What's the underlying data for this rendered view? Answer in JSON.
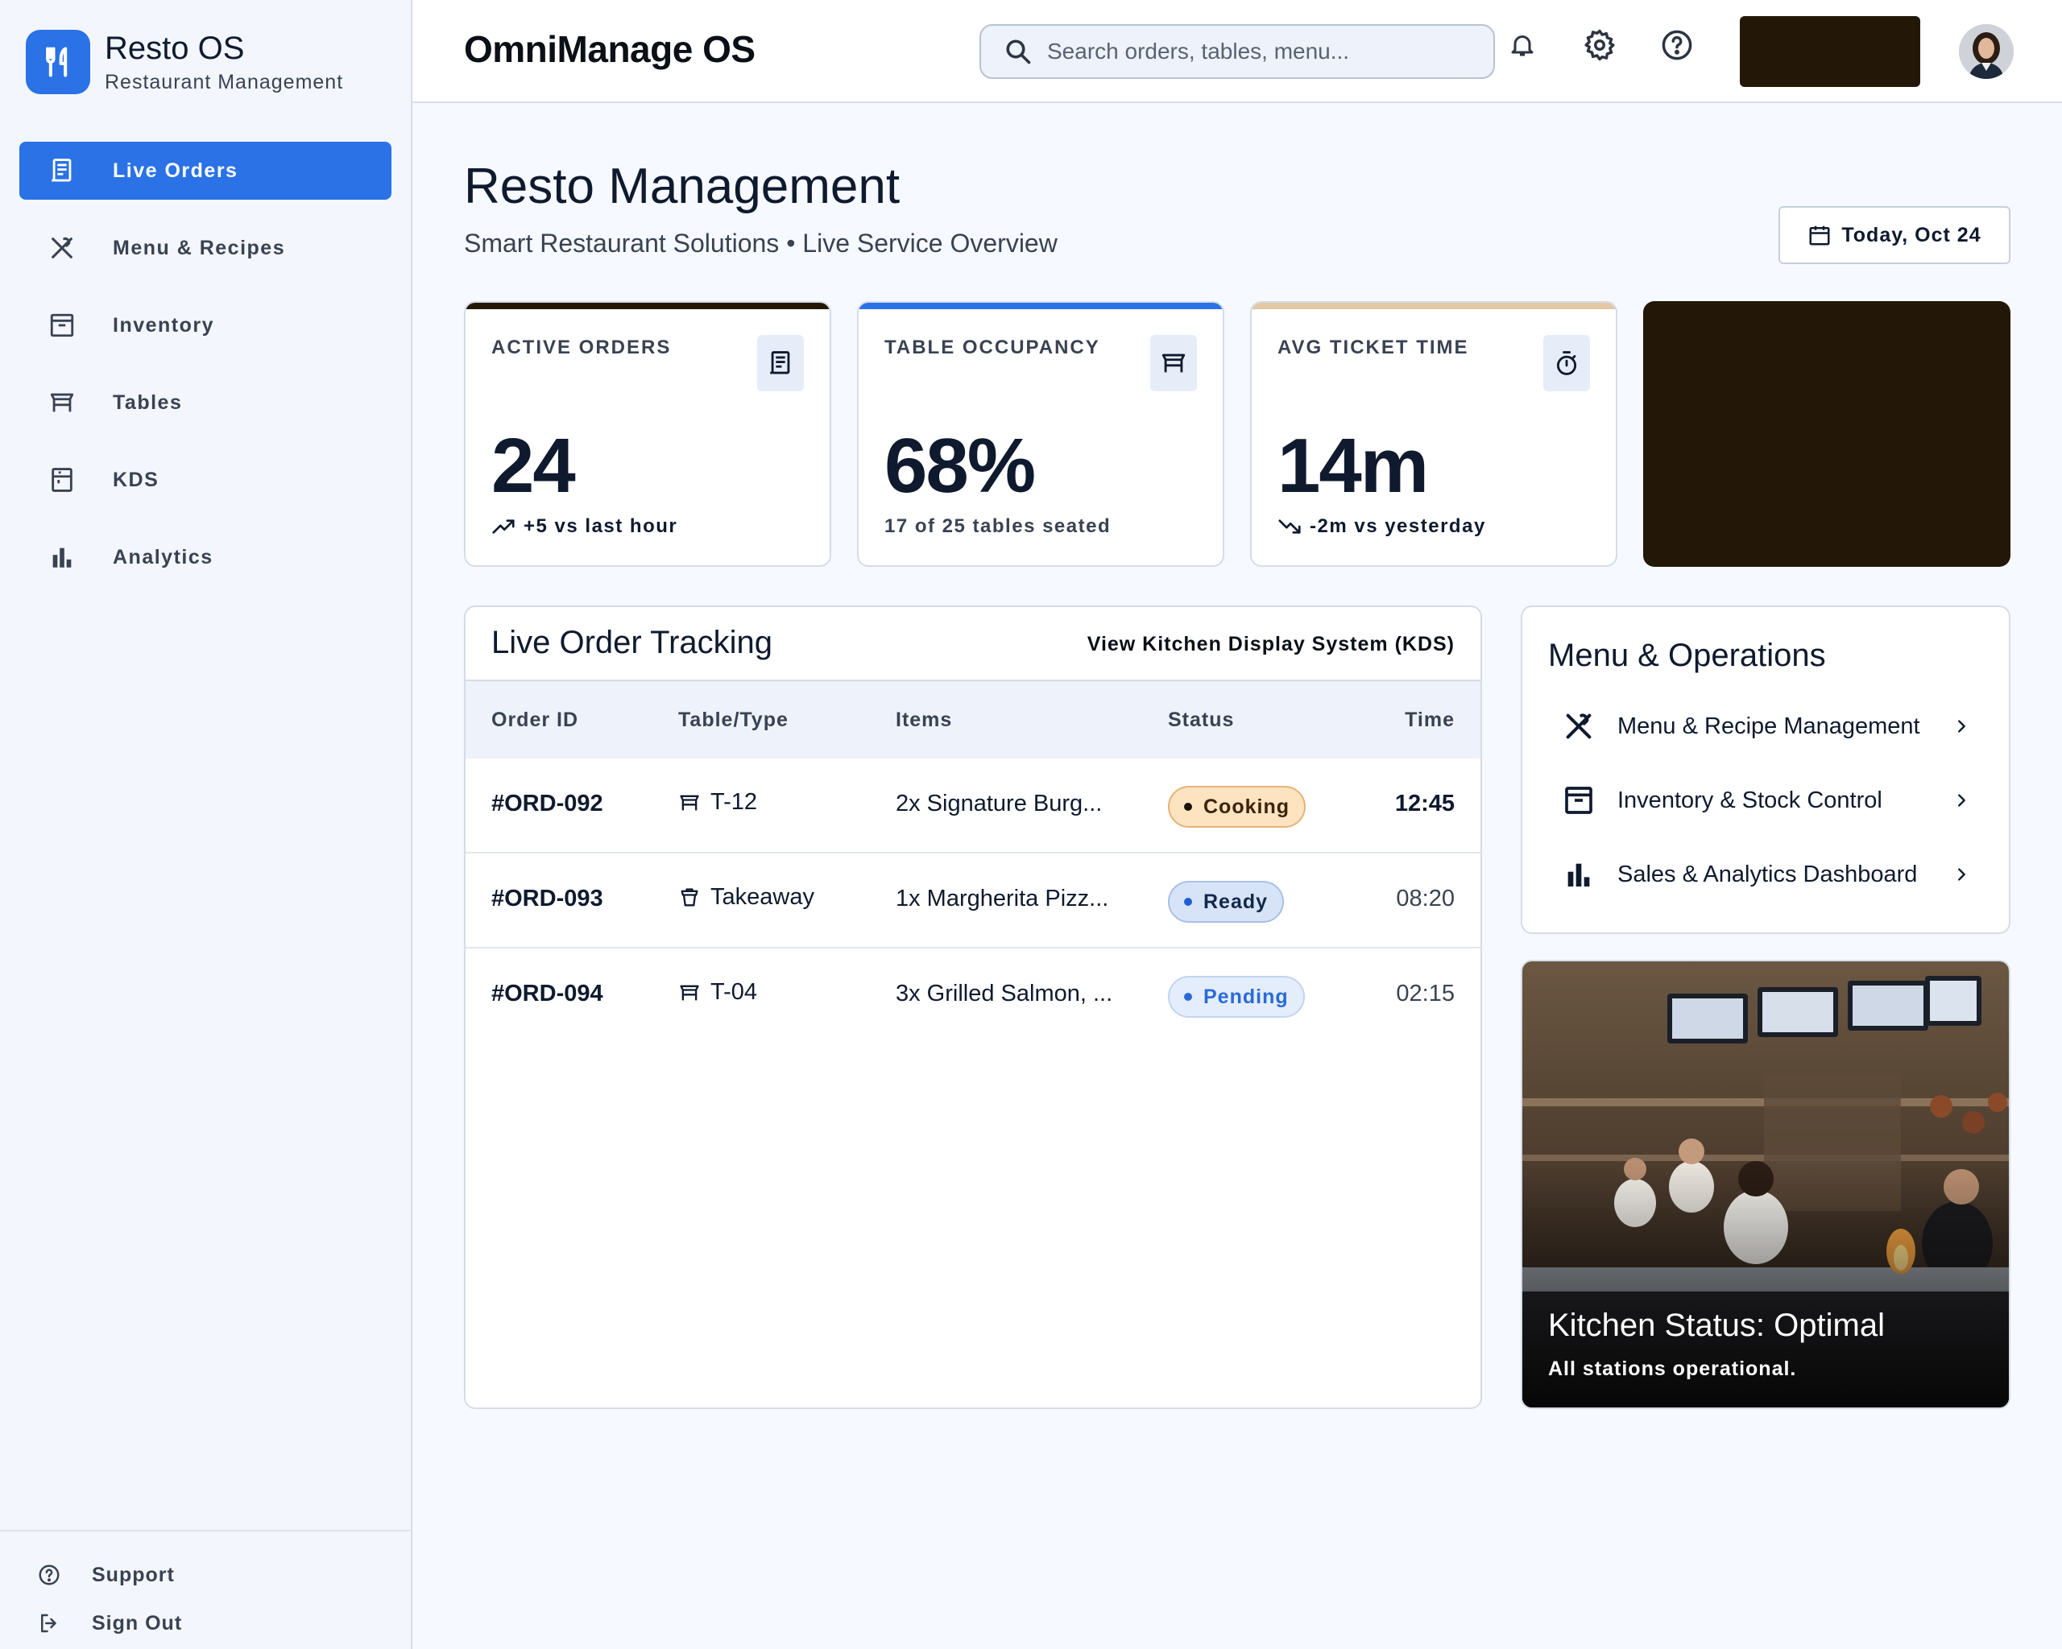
{
  "brand": {
    "title": "Resto OS",
    "subtitle": "Restaurant Management"
  },
  "sidebar": {
    "items": [
      {
        "label": "Live Orders",
        "icon": "receipt-icon",
        "active": true
      },
      {
        "label": "Menu & Recipes",
        "icon": "utensils-crossed-icon"
      },
      {
        "label": "Inventory",
        "icon": "archive-box-icon"
      },
      {
        "label": "Tables",
        "icon": "table-icon"
      },
      {
        "label": "KDS",
        "icon": "kds-screen-icon"
      },
      {
        "label": "Analytics",
        "icon": "bar-chart-icon"
      }
    ],
    "footer": [
      {
        "label": "Support",
        "icon": "help-circle-icon"
      },
      {
        "label": "Sign Out",
        "icon": "logout-icon"
      }
    ]
  },
  "header": {
    "app_title": "OmniManage OS",
    "search_placeholder": "Search orders, tables, menu..."
  },
  "page": {
    "title": "Resto Management",
    "subtitle": "Smart Restaurant Solutions • Live Service Overview",
    "date_label": "Today, Oct 24"
  },
  "stats": [
    {
      "caption": "ACTIVE ORDERS",
      "value": "24",
      "note": "+5 vs last hour",
      "trend": "up",
      "accent": "#231807"
    },
    {
      "caption": "TABLE OCCUPANCY",
      "value": "68%",
      "note": "17 of 25 tables seated",
      "trend": "none",
      "accent": "#2a72e6"
    },
    {
      "caption": "AVG TICKET TIME",
      "value": "14m",
      "note": "-2m vs yesterday",
      "trend": "down",
      "accent": "#e3c8a4"
    }
  ],
  "orders": {
    "title": "Live Order Tracking",
    "link": "View Kitchen Display System (KDS)",
    "columns": [
      "Order ID",
      "Table/Type",
      "Items",
      "Status",
      "Time"
    ],
    "rows": [
      {
        "id": "#ORD-092",
        "table": "T-12",
        "type_icon": "table-icon",
        "items": "2x Signature Burg...",
        "status": "Cooking",
        "time": "12:45"
      },
      {
        "id": "#ORD-093",
        "table": "Takeaway",
        "type_icon": "takeaway-bag-icon",
        "items": "1x Margherita Pizz...",
        "status": "Ready",
        "time": "08:20"
      },
      {
        "id": "#ORD-094",
        "table": "T-04",
        "type_icon": "table-icon",
        "items": "3x Grilled Salmon, ...",
        "status": "Pending",
        "time": "02:15"
      }
    ]
  },
  "ops": {
    "title": "Menu & Operations",
    "items": [
      {
        "label": "Menu & Recipe Management",
        "icon": "utensils-crossed-icon"
      },
      {
        "label": "Inventory & Stock Control",
        "icon": "archive-box-icon"
      },
      {
        "label": "Sales & Analytics Dashboard",
        "icon": "bar-chart-icon"
      }
    ]
  },
  "kitchen": {
    "title": "Kitchen Status: Optimal",
    "subtitle": "All stations operational."
  },
  "colors": {
    "primary": "#2a72e6",
    "dark_brown": "#231807",
    "tan": "#e3c8a4",
    "cooking": "#fde3c0",
    "ready": "#d7e4f8",
    "pending": "#e4edfb"
  }
}
